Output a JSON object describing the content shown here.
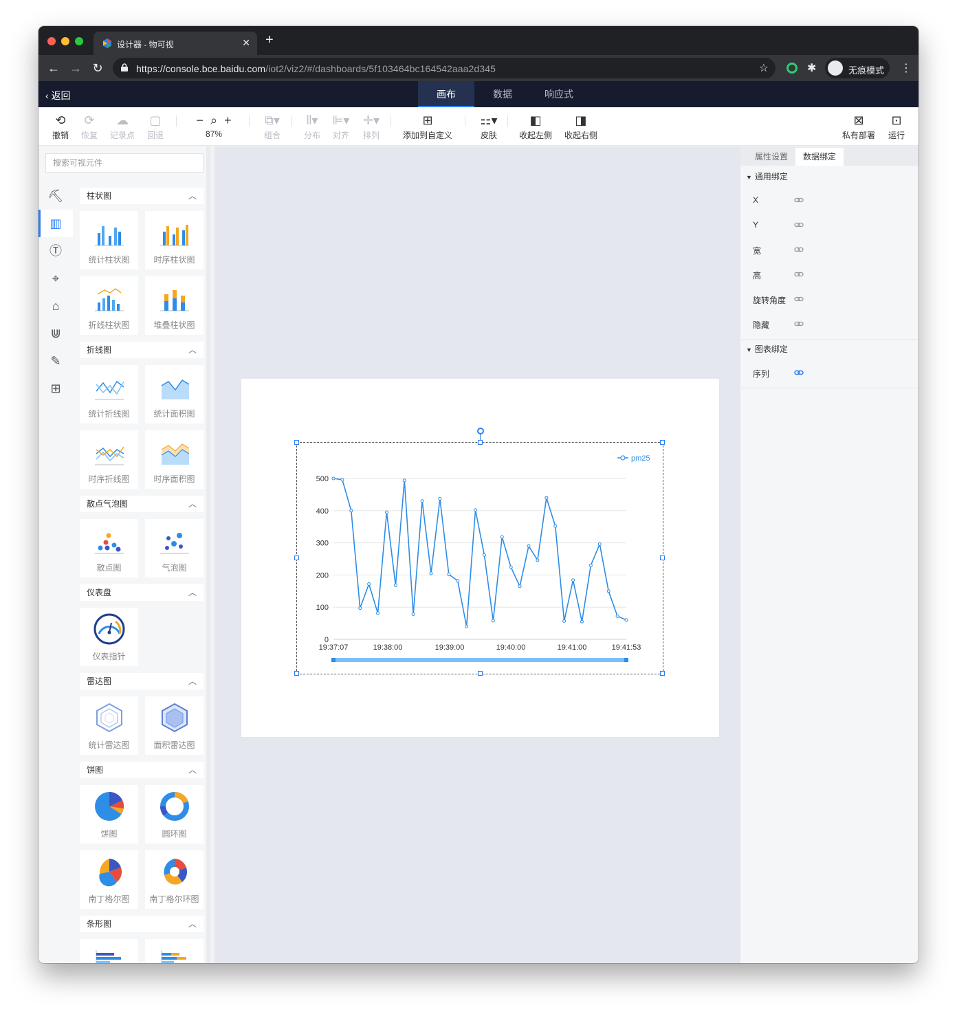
{
  "browser": {
    "tab_title": "设计器 - 物可视",
    "url_host": "https://console.bce.baidu.com",
    "url_path": "/iot2/viz2/#/dashboards/5f103464bc164542aaa2d345",
    "incognito_label": "无痕模式"
  },
  "header": {
    "back_label": "返回",
    "tabs": [
      {
        "label": "画布",
        "active": true
      },
      {
        "label": "数据",
        "active": false
      },
      {
        "label": "响应式",
        "active": false
      }
    ]
  },
  "toolbar": {
    "undo": "撤销",
    "redo": "恢复",
    "snapshot": "记录点",
    "rollback": "回退",
    "zoom": "87%",
    "group": "组合",
    "distribute": "分布",
    "align": "对齐",
    "arrange": "排列",
    "add_custom": "添加到自定义",
    "skin": "皮肤",
    "collapse_left": "收起左侧",
    "collapse_right": "收起右侧",
    "private_deploy": "私有部署",
    "run": "运行"
  },
  "left_panel": {
    "search_placeholder": "搜索可视元件",
    "categories": [
      {
        "title": "柱状图",
        "items": [
          "统计柱状图",
          "时序柱状图",
          "折线柱状图",
          "堆叠柱状图"
        ]
      },
      {
        "title": "折线图",
        "items": [
          "统计折线图",
          "统计面积图",
          "时序折线图",
          "时序面积图"
        ]
      },
      {
        "title": "散点气泡图",
        "items": [
          "散点图",
          "气泡图"
        ]
      },
      {
        "title": "仪表盘",
        "items": [
          "仪表指针"
        ]
      },
      {
        "title": "雷达图",
        "items": [
          "统计雷达图",
          "面积雷达图"
        ]
      },
      {
        "title": "饼图",
        "items": [
          "饼图",
          "圆环图",
          "南丁格尔图",
          "南丁格尔环图"
        ]
      },
      {
        "title": "条形图",
        "items": [
          "",
          ""
        ]
      }
    ]
  },
  "right_panel": {
    "tabs": [
      {
        "label": "属性设置",
        "active": false
      },
      {
        "label": "数据绑定",
        "active": true
      }
    ],
    "general_title": "通用绑定",
    "general_rows": [
      "X",
      "Y",
      "宽",
      "高",
      "旋转角度",
      "隐藏"
    ],
    "chart_title": "图表绑定",
    "chart_rows": [
      "序列"
    ]
  },
  "chart_data": {
    "type": "line",
    "series": [
      {
        "name": "pm25",
        "color": "#2e8de6",
        "values": [
          500,
          496,
          400,
          97,
          172,
          81,
          395,
          168,
          494,
          78,
          430,
          205,
          437,
          202,
          182,
          40,
          402,
          262,
          58,
          318,
          224,
          165,
          290,
          246,
          440,
          352,
          57,
          184,
          55,
          230,
          296,
          150,
          72,
          60
        ]
      }
    ],
    "x_tick_labels": [
      "19:37:07",
      "19:38:00",
      "19:39:00",
      "19:40:00",
      "19:41:00",
      "19:41:53"
    ],
    "x_range": [
      "19:37:07",
      "19:41:53"
    ],
    "y_ticks": [
      0,
      100,
      200,
      300,
      400,
      500
    ],
    "ylim": [
      0,
      500
    ],
    "legend_position": "top-right",
    "grid": true,
    "data_zoom_slider": true
  }
}
